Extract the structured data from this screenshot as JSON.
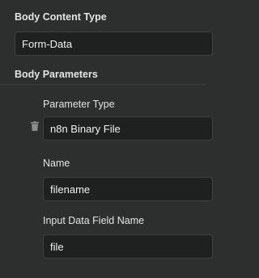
{
  "body_content_type": {
    "label": "Body Content Type",
    "value": "Form-Data"
  },
  "body_parameters": {
    "title": "Body Parameters",
    "items": [
      {
        "parameter_type_label": "Parameter Type",
        "parameter_type_value": "n8n Binary File",
        "name_label": "Name",
        "name_value": "filename",
        "input_field_label": "Input Data Field Name",
        "input_field_value": "file"
      }
    ]
  },
  "icons": {
    "delete": "trash-icon"
  },
  "colors": {
    "background": "#2d2e2e",
    "field_background": "#1f2020",
    "field_border": "#3f4040",
    "text": "#e4e4e4"
  }
}
